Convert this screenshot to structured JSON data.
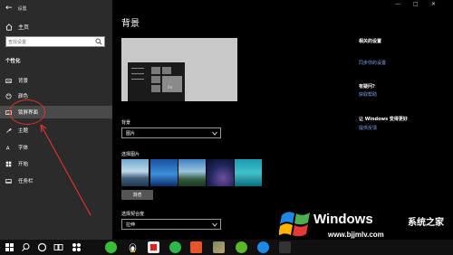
{
  "window": {
    "title": "设置",
    "back_icon": "back-arrow-icon",
    "controls": [
      "—",
      "□",
      "✕"
    ]
  },
  "sidebar": {
    "home": "主页",
    "search_placeholder": "查找设置",
    "section": "个性化",
    "items": [
      {
        "label": "背景",
        "icon": "image-icon"
      },
      {
        "label": "颜色",
        "icon": "palette-icon"
      },
      {
        "label": "锁屏界面",
        "icon": "lock-screen-icon",
        "active": true
      },
      {
        "label": "主题",
        "icon": "brush-icon"
      },
      {
        "label": "字体",
        "icon": "font-icon"
      },
      {
        "label": "开始",
        "icon": "start-icon"
      },
      {
        "label": "任务栏",
        "icon": "taskbar-icon"
      }
    ]
  },
  "main": {
    "title": "背景",
    "preview_text": "Aa",
    "background_label": "背景",
    "background_value": "图片",
    "choose_picture_label": "选择图片",
    "browse_button": "浏览",
    "fit_label": "选择契合度",
    "fit_value": "拉伸"
  },
  "related": {
    "related_settings_heading": "相关的设置",
    "related_settings_link": "同步你的设置",
    "questions_heading": "有疑问?",
    "questions_link": "获取帮助",
    "improve_heading": "让 Windows 变得更好",
    "improve_link": "提供反馈"
  },
  "taskbar": {
    "icons": [
      "windows-start-icon",
      "search-icon",
      "cortana-icon",
      "task-view-icon",
      "grid-icon",
      "app-green-icon",
      "penguin-icon",
      "app-red-icon",
      "chat-icon",
      "app-orange-icon",
      "app-image-icon",
      "app-green2-icon",
      "app-blue-icon",
      "app-dark-icon"
    ]
  },
  "watermark": {
    "name": "Windows",
    "cn": "系统之家",
    "url": "www.bjjmlv.com"
  },
  "colors": {
    "sidebar_bg": "#2b2b2b",
    "main_bg": "#000000",
    "link": "#7aa6e8",
    "annotation": "#e03030"
  }
}
